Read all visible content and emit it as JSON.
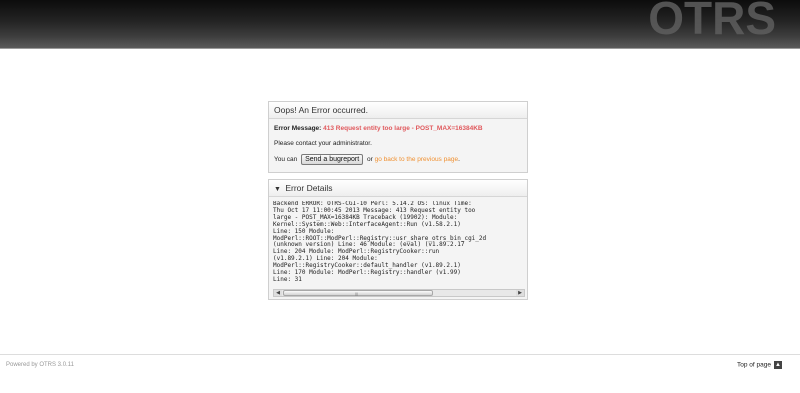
{
  "header": {
    "logo": "OTRS"
  },
  "error_box": {
    "title": "Oops! An Error occurred.",
    "message_label": "Error Message:",
    "message_value": "413 Request entity too large - POST_MAX=16384KB",
    "contact_text": "Please contact your administrator.",
    "you_can_text": "You can",
    "bugreport_button": "Send a bugreport",
    "or_text": "or",
    "go_back_link": "go back to the previous page",
    "period": "."
  },
  "details_box": {
    "title": "Error Details",
    "text": "Backend ERROR: OTRS-CGI-10 Perl: 5.14.2 OS: linux Time:\nThu Oct 17 11:00:45 2013 Message: 413 Request entity too\nlarge - POST_MAX=16384KB Traceback (19902): Module:\nKernel::System::Web::InterfaceAgent::Run (v1.58.2.1)\nLine: 150 Module:\nModPerl::ROOT::ModPerl::Registry::usr_share_otrs_bin_cgi_2d\n(unknown version) Line: 46 Module: (eval) (v1.89.2.17\nLine: 204 Module: ModPerl::RegistryCooker::run\n(v1.89.2.1) Line: 204 Module:\nModPerl::RegistryCooker::default_handler (v1.89.2.1)\nLine: 170 Module: ModPerl::Registry::handler (v1.99)\nLine: 31"
  },
  "footer": {
    "powered_by": "Powered by OTRS 3.0.11",
    "top_of_page": "Top of page"
  },
  "colors": {
    "error_message": "#e0585c",
    "link": "#f09030",
    "header_dark": "#0c0c0c"
  }
}
